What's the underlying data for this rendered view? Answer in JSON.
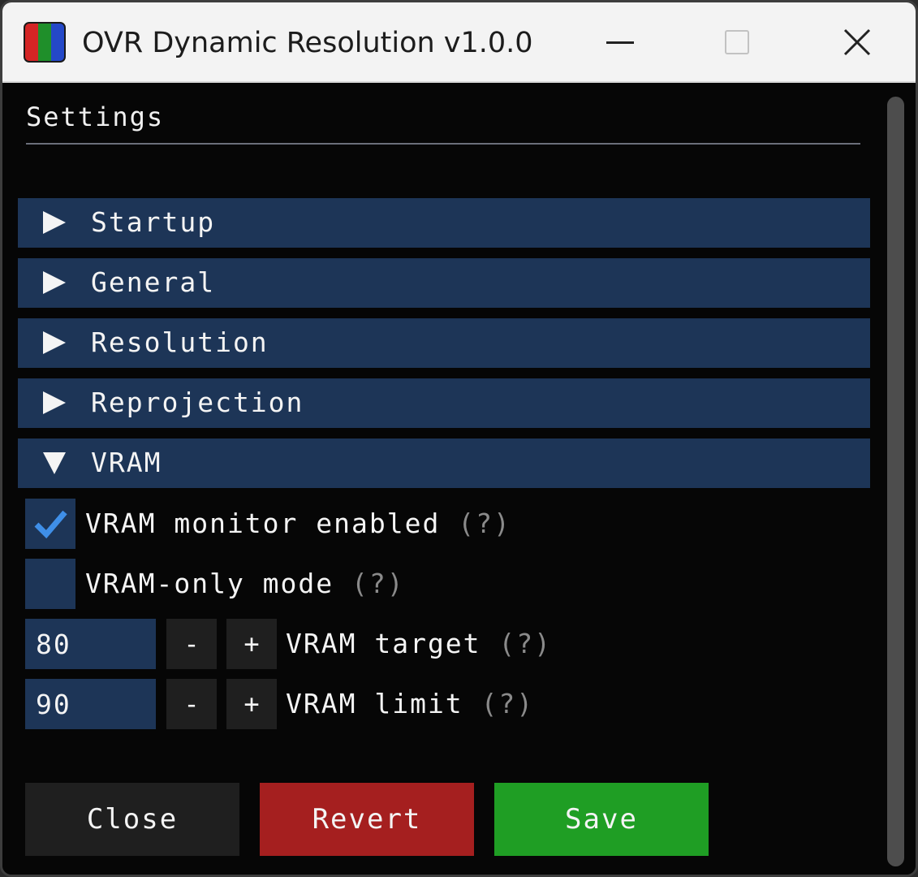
{
  "window": {
    "title": "OVR Dynamic Resolution v1.0.0",
    "icon_colors": [
      "#d42525",
      "#1f8f2a",
      "#2448c8"
    ]
  },
  "settings": {
    "title": "Settings"
  },
  "sections": [
    {
      "label": "Startup",
      "expanded": false
    },
    {
      "label": "General",
      "expanded": false
    },
    {
      "label": "Resolution",
      "expanded": false
    },
    {
      "label": "Reprojection",
      "expanded": false
    },
    {
      "label": "VRAM",
      "expanded": true
    }
  ],
  "vram": {
    "monitor": {
      "label": "VRAM monitor enabled",
      "help": "(?)",
      "checked": true
    },
    "only_mode": {
      "label": "VRAM-only mode",
      "help": "(?)",
      "checked": false
    },
    "target": {
      "value": "80",
      "minus": "-",
      "plus": "+",
      "label": "VRAM target",
      "help": "(?)"
    },
    "limit": {
      "value": "90",
      "minus": "-",
      "plus": "+",
      "label": "VRAM limit",
      "help": "(?)"
    }
  },
  "buttons": {
    "close": {
      "label": "Close",
      "color": "#1f1f1f"
    },
    "revert": {
      "label": "Revert",
      "color": "#a51f1f"
    },
    "save": {
      "label": "Save",
      "color": "#1f9e24"
    }
  },
  "colors": {
    "accent": "#1d3557",
    "check": "#3f8fe8",
    "background": "#060606"
  }
}
